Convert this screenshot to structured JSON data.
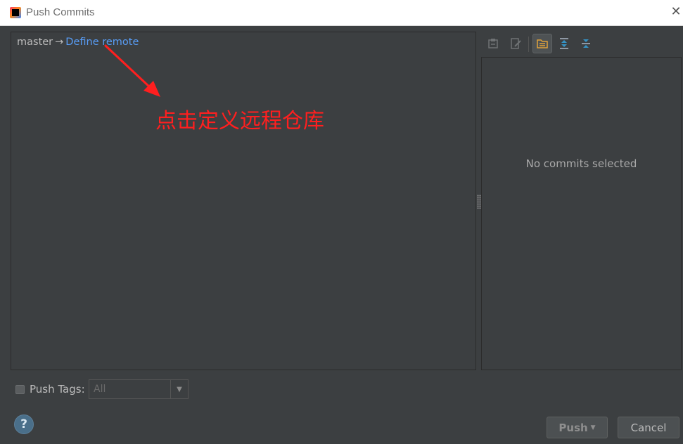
{
  "window": {
    "title": "Push Commits",
    "close_glyph": "✕",
    "icon": "intellij-app-icon"
  },
  "push_tree": {
    "branch": "master",
    "arrow": "→",
    "define_remote_label": "Define remote"
  },
  "annotation": {
    "text": "点击定义远程仓库",
    "color": "#ff1f1f"
  },
  "toolbar": {
    "buttons": [
      {
        "icon": "cherry-pick-icon",
        "active": false
      },
      {
        "icon": "edit-source-icon",
        "active": false
      },
      {
        "icon": "group-by-folder-icon",
        "active": true
      },
      {
        "icon": "expand-all-icon",
        "active": false
      },
      {
        "icon": "collapse-all-icon",
        "active": false
      }
    ]
  },
  "details": {
    "empty_message": "No commits selected"
  },
  "push_tags": {
    "checked": false,
    "label": "Push Tags:",
    "select_value": "All"
  },
  "footer": {
    "help_label": "?",
    "push_label": "Push",
    "cancel_label": "Cancel"
  },
  "colors": {
    "panel_bg": "#3c3f41",
    "link": "#589df6",
    "text": "#bbbbbb",
    "title_bar": "#ffffff"
  }
}
